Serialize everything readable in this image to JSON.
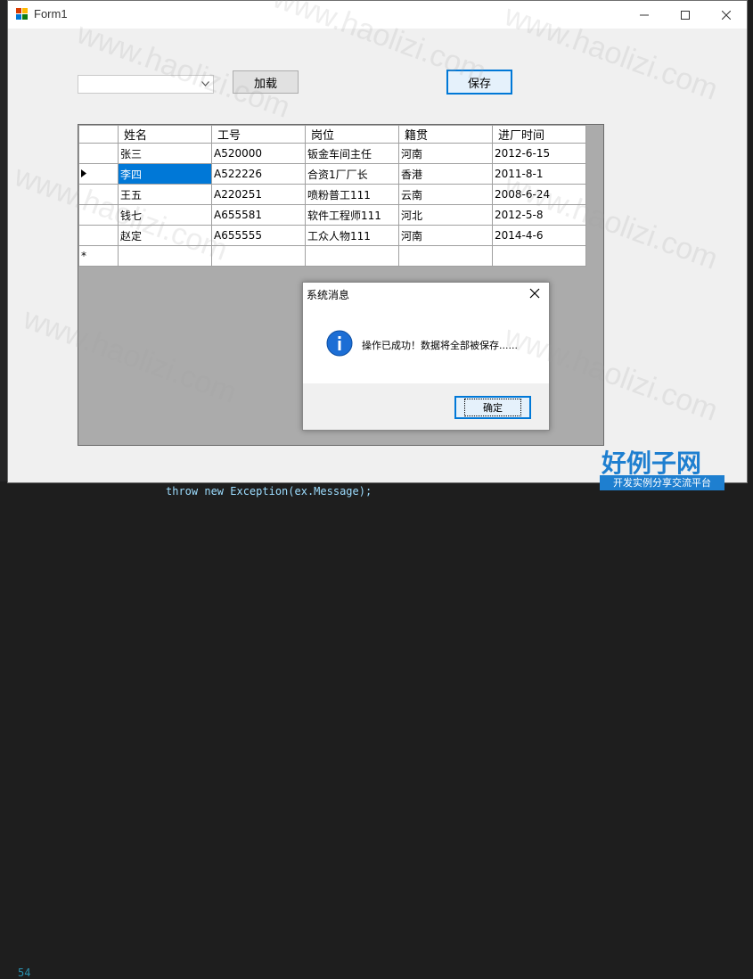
{
  "window": {
    "title": "Form1"
  },
  "controls": {
    "combo_value": "",
    "load_label": "加载",
    "save_label": "保存"
  },
  "grid": {
    "columns": [
      "姓名",
      "工号",
      "岗位",
      "籍贯",
      "进厂时间"
    ],
    "rows": [
      {
        "name": "张三",
        "id": "A520000",
        "position": "钣金车间主任",
        "hometown": "河南",
        "date": "2012-6-15"
      },
      {
        "name": "李四",
        "id": "A522226",
        "position": "合资1厂厂长",
        "hometown": "香港",
        "date": "2011-8-1"
      },
      {
        "name": "王五",
        "id": "A220251",
        "position": "喷粉普工111",
        "hometown": "云南",
        "date": "2008-6-24"
      },
      {
        "name": "钱七",
        "id": "A655581",
        "position": "软件工程师111",
        "hometown": "河北",
        "date": "2012-5-8"
      },
      {
        "name": "赵定",
        "id": "A655555",
        "position": "工众人物111",
        "hometown": "河南",
        "date": "2014-4-6"
      }
    ],
    "new_row_marker": "*"
  },
  "dialog": {
    "title": "系统消息",
    "message": "操作已成功！数据将全部被保存......",
    "ok_label": "确定"
  },
  "watermark": {
    "text": "www.haolizi.com",
    "logo_main": "好例子网",
    "logo_sub": "开发实例分享交流平台"
  },
  "ide": {
    "line_number": "54",
    "code": "throw new Exception(ex.Message);"
  },
  "colors": {
    "selection": "#0078d7",
    "accent_border": "#0078d7",
    "grid_background": "#ababab",
    "logo_blue": "#1e7fd0"
  }
}
